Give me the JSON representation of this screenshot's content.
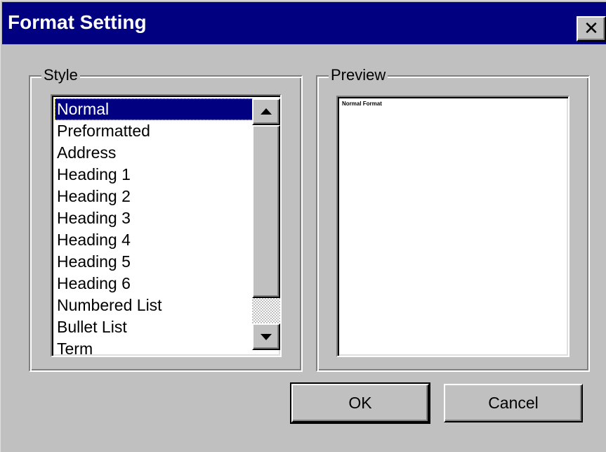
{
  "window": {
    "title": "Format Setting",
    "close_glyph": "✕"
  },
  "style_group": {
    "legend": "Style",
    "items": [
      "Normal",
      "Preformatted",
      "Address",
      "Heading 1",
      "Heading 2",
      "Heading 3",
      "Heading 4",
      "Heading 5",
      "Heading 6",
      "Numbered List",
      "Bullet List",
      "Term"
    ],
    "selected": "Normal"
  },
  "preview_group": {
    "legend": "Preview",
    "sample_text": "Normal Format"
  },
  "buttons": {
    "ok_label": "OK",
    "cancel_label": "Cancel"
  },
  "colors": {
    "titlebar": "#000080",
    "dialog_face": "#c0c0c0",
    "selection": "#000080"
  },
  "icons": {
    "close": "close-icon",
    "scroll_up": "scroll-up-arrow-icon",
    "scroll_down": "scroll-down-arrow-icon"
  }
}
